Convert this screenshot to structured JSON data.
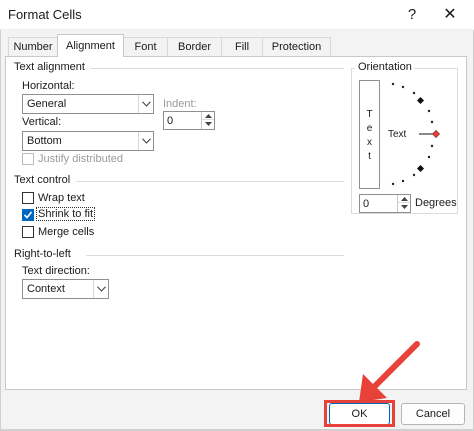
{
  "window": {
    "title": "Format Cells",
    "help_glyph": "?",
    "close_glyph": "✕"
  },
  "tabs": [
    {
      "label": "Number"
    },
    {
      "label": "Alignment",
      "active": true
    },
    {
      "label": "Font"
    },
    {
      "label": "Border"
    },
    {
      "label": "Fill"
    },
    {
      "label": "Protection"
    }
  ],
  "text_alignment": {
    "group_label": "Text alignment",
    "horizontal_label": "Horizontal:",
    "horizontal_value": "General",
    "vertical_label": "Vertical:",
    "vertical_value": "Bottom",
    "indent_label": "Indent:",
    "indent_value": "0",
    "justify_distributed_label": "Justify distributed",
    "justify_distributed_checked": false,
    "justify_distributed_enabled": false
  },
  "text_control": {
    "group_label": "Text control",
    "wrap_text_label": "Wrap text",
    "wrap_text_checked": false,
    "shrink_to_fit_label": "Shrink to fit",
    "shrink_to_fit_checked": true,
    "merge_cells_label": "Merge cells",
    "merge_cells_checked": false
  },
  "right_to_left": {
    "group_label": "Right-to-left",
    "text_direction_label": "Text direction:",
    "text_direction_value": "Context"
  },
  "orientation": {
    "group_label": "Orientation",
    "vertical_text": [
      "T",
      "e",
      "x",
      "t"
    ],
    "dial_text": "Text",
    "degrees_value": "0",
    "degrees_label": "Degrees"
  },
  "buttons": {
    "ok_label": "OK",
    "cancel_label": "Cancel"
  },
  "colors": {
    "accent": "#0067c0",
    "highlight": "#e8413a",
    "dial_marker": "#e8413a"
  }
}
